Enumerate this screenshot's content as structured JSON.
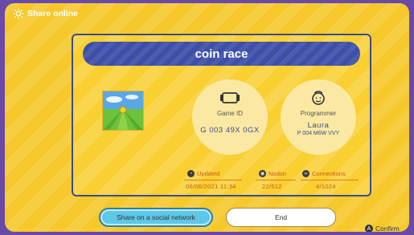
{
  "topbar": {
    "title": "Share online",
    "icon": "sun-icon"
  },
  "game": {
    "title": "coin race",
    "game_id_label": "Game ID",
    "game_id": "G 003 49X 0GX",
    "programmer_label": "Programmer",
    "programmer_name": "Laura",
    "programmer_id": "P 004 M6W VVY"
  },
  "stats": {
    "updated_label": "Updated",
    "updated_value": "06/06/2021 11:34",
    "nodon_label": "Nodon",
    "nodon_value": "22/512",
    "connections_label": "Connections",
    "connections_value": "4/1024"
  },
  "buttons": {
    "share": "Share on a social network",
    "end": "End",
    "confirm": "Confirm",
    "confirm_key": "A"
  },
  "colors": {
    "background": "#f6c82b",
    "accent": "#3d4fa8",
    "highlight": "#5fc7e8",
    "frame": "#6a4aa8"
  }
}
